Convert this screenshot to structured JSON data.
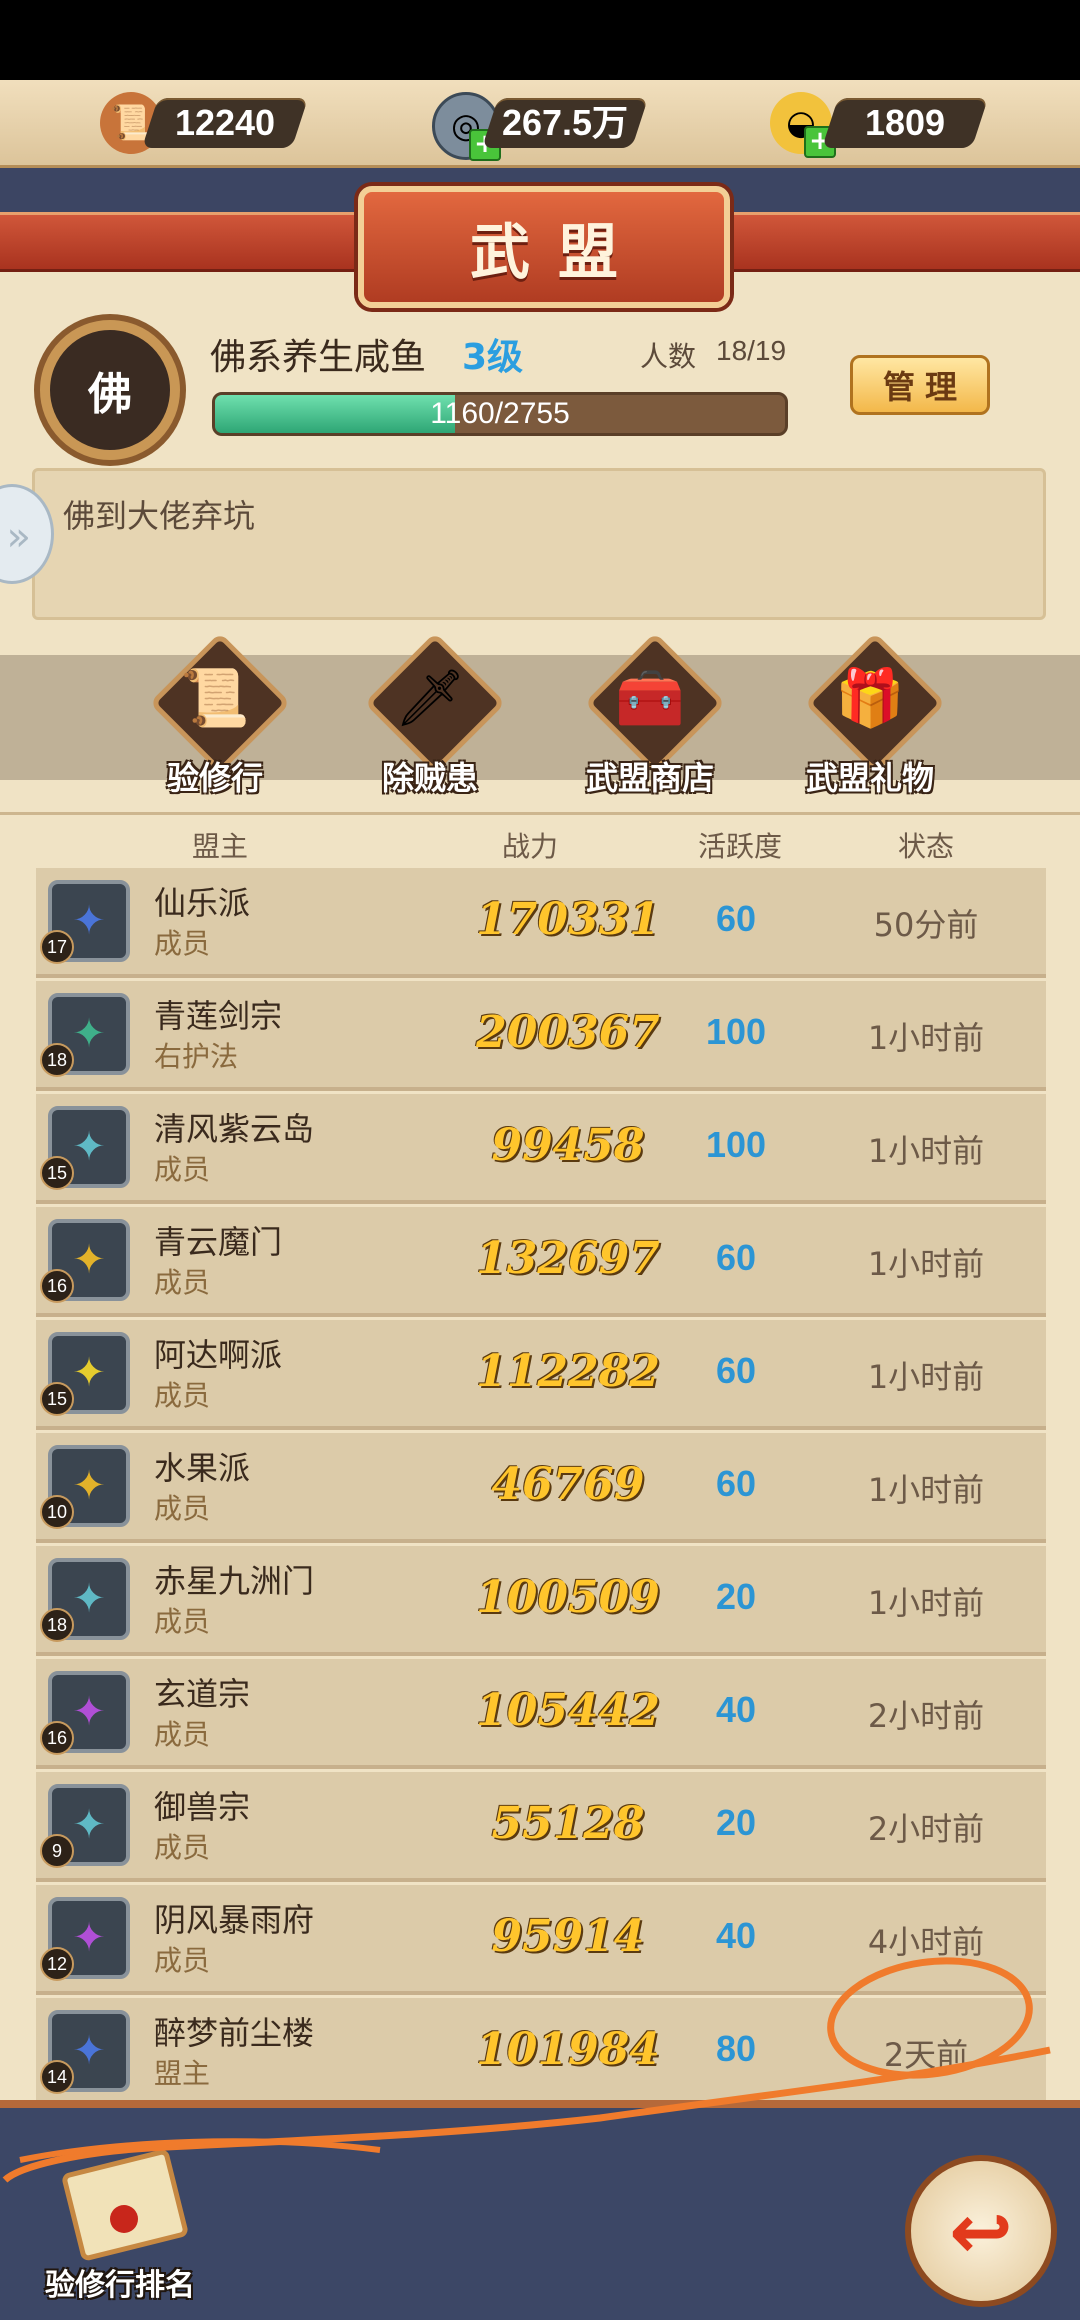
{
  "resources": {
    "scroll_count": "12240",
    "coins": "267.5万",
    "gold": "1809"
  },
  "title": "武盟",
  "guild": {
    "emblem_char": "佛",
    "name": "佛系养生咸鱼",
    "level": "3级",
    "members_label": "人数",
    "members_value": "18/19",
    "exp_text": "1160/2755",
    "exp_progress": 0.421,
    "manage_label": "管理",
    "notice": "佛到大佬弃坑"
  },
  "functions": [
    {
      "label": "验修行",
      "icon": "scroll-icon"
    },
    {
      "label": "除贼患",
      "icon": "sword-icon"
    },
    {
      "label": "武盟商店",
      "icon": "shop-chest-icon"
    },
    {
      "label": "武盟礼物",
      "icon": "gift-chest-icon"
    }
  ],
  "table": {
    "headers": [
      "盟主",
      "战力",
      "活跃度",
      "状态"
    ],
    "rows": [
      {
        "level": "17",
        "name": "仙乐派",
        "role": "成员",
        "power": "170331",
        "activity": "60",
        "status": "50分前",
        "icon_color": "#4a74d8"
      },
      {
        "level": "18",
        "name": "青莲剑宗",
        "role": "右护法",
        "power": "200367",
        "activity": "100",
        "status": "1小时前",
        "icon_color": "#3fb08a"
      },
      {
        "level": "15",
        "name": "清风紫云岛",
        "role": "成员",
        "power": "99458",
        "activity": "100",
        "status": "1小时前",
        "icon_color": "#5fb9c5"
      },
      {
        "level": "16",
        "name": "青云魔门",
        "role": "成员",
        "power": "132697",
        "activity": "60",
        "status": "1小时前",
        "icon_color": "#e3b22a"
      },
      {
        "level": "15",
        "name": "阿达啊派",
        "role": "成员",
        "power": "112282",
        "activity": "60",
        "status": "1小时前",
        "icon_color": "#e5cc2e"
      },
      {
        "level": "10",
        "name": "水果派",
        "role": "成员",
        "power": "46769",
        "activity": "60",
        "status": "1小时前",
        "icon_color": "#e3b22a"
      },
      {
        "level": "18",
        "name": "赤星九洲门",
        "role": "成员",
        "power": "100509",
        "activity": "20",
        "status": "1小时前",
        "icon_color": "#5fb9c5"
      },
      {
        "level": "16",
        "name": "玄道宗",
        "role": "成员",
        "power": "105442",
        "activity": "40",
        "status": "2小时前",
        "icon_color": "#b04fd6"
      },
      {
        "level": "9",
        "name": "御兽宗",
        "role": "成员",
        "power": "55128",
        "activity": "20",
        "status": "2小时前",
        "icon_color": "#5fb9c5"
      },
      {
        "level": "12",
        "name": "阴风暴雨府",
        "role": "成员",
        "power": "95914",
        "activity": "40",
        "status": "4小时前",
        "icon_color": "#b04fd6"
      },
      {
        "level": "14",
        "name": "醉梦前尘楼",
        "role": "盟主",
        "power": "101984",
        "activity": "80",
        "status": "2天前",
        "icon_color": "#4a74d8"
      }
    ]
  },
  "bottom": {
    "rank_label": "验修行排名",
    "back_icon": "back-arrow-icon"
  }
}
